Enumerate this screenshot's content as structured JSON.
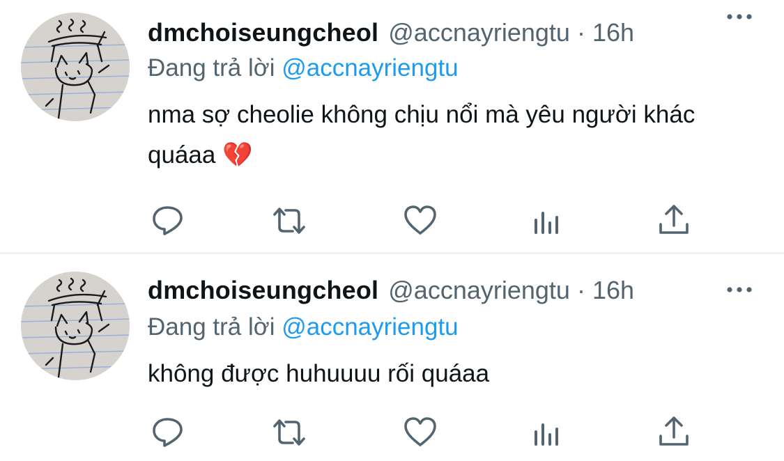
{
  "colors": {
    "accent": "#1d9bf0",
    "secondary_text": "#536471",
    "primary_text": "#0f1419",
    "divider": "#eff3f4"
  },
  "icons": {
    "more": "more-horizontal-icon",
    "reply": "reply-icon",
    "retweet": "retweet-icon",
    "like": "heart-icon",
    "views": "analytics-icon",
    "share": "share-icon"
  },
  "tweets": [
    {
      "display_name": "dmchoiseungcheol",
      "handle": "@accnayriengtu",
      "separator": "·",
      "time": "16h",
      "reply_prefix": "Đang trả lời",
      "reply_handle": "@accnayriengtu",
      "text": "nma sợ cheolie không chịu nổi mà yêu người khác quáaa 💔"
    },
    {
      "display_name": "dmchoiseungcheol",
      "handle": "@accnayriengtu",
      "separator": "·",
      "time": "16h",
      "reply_prefix": "Đang trả lời",
      "reply_handle": "@accnayriengtu",
      "text": "không được huhuuuu rối quáaa"
    }
  ]
}
